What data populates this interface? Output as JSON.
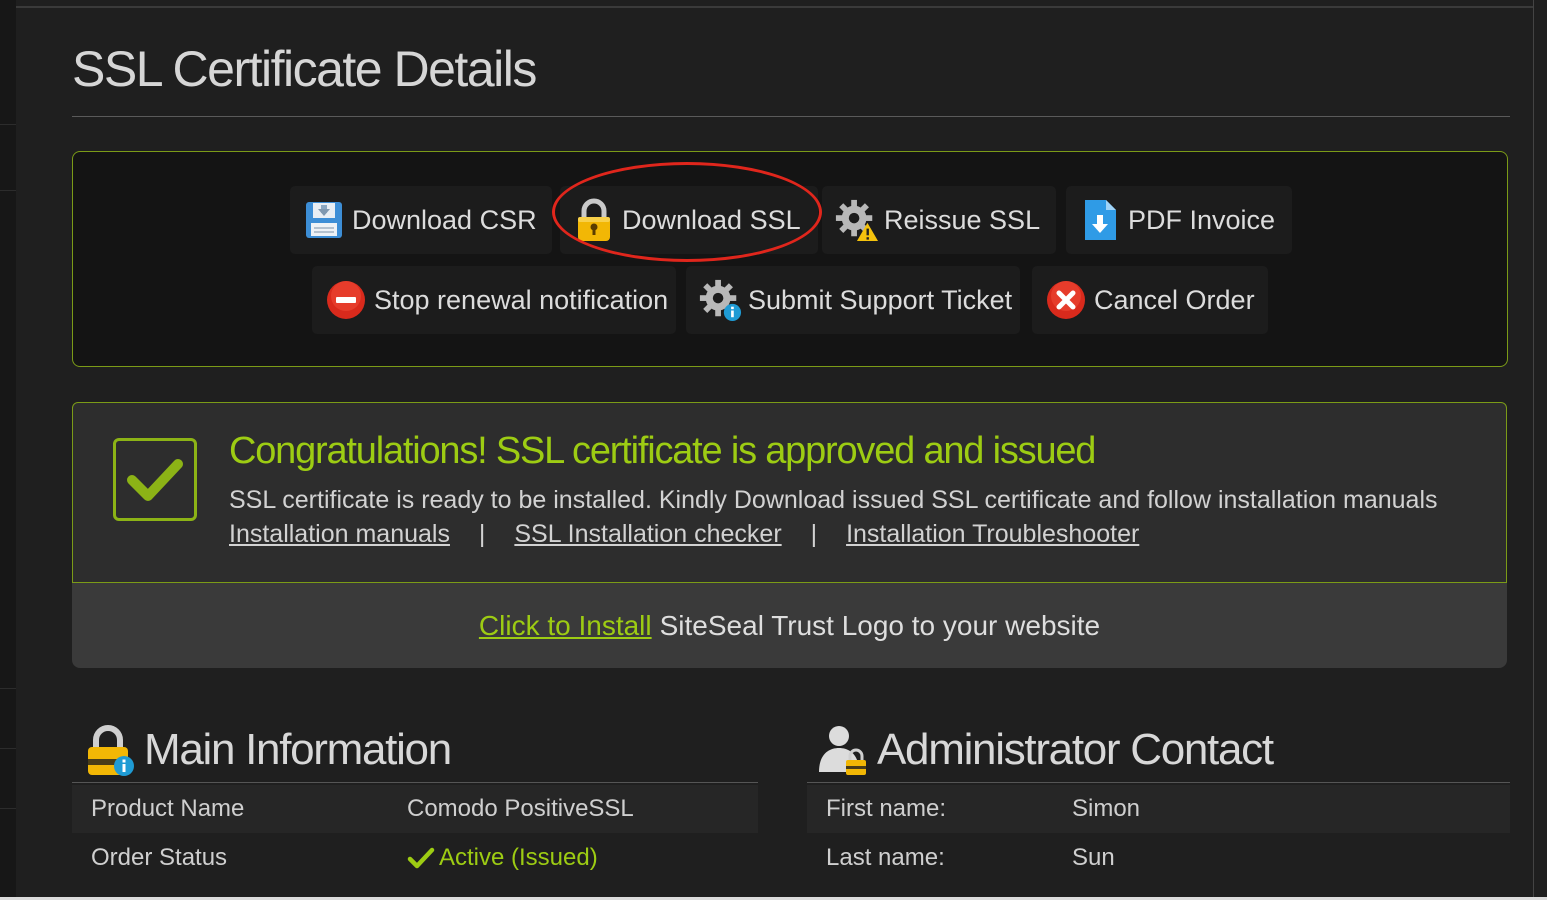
{
  "page": {
    "title": "SSL Certificate Details"
  },
  "actions": {
    "download_csr": "Download CSR",
    "download_ssl": "Download SSL",
    "reissue_ssl": "Reissue SSL",
    "pdf_invoice": "PDF Invoice",
    "stop_renewal": "Stop renewal notification",
    "submit_ticket": "Submit Support Ticket",
    "cancel_order": "Cancel Order"
  },
  "alert": {
    "title": "Congratulations! SSL certificate is approved and issued",
    "text": "SSL certificate is ready to be installed. Kindly Download issued SSL certificate and follow installation manuals",
    "links": [
      "Installation manuals",
      "SSL Installation checker",
      "Installation Troubleshooter"
    ],
    "separator": "|"
  },
  "siteseal": {
    "link": "Click to Install",
    "text": "SiteSeal Trust Logo to your website"
  },
  "main_info": {
    "title": "Main Information",
    "rows": [
      {
        "label": "Product Name",
        "value": "Comodo PositiveSSL"
      },
      {
        "label": "Order Status",
        "value": "Active (Issued)"
      }
    ]
  },
  "admin_contact": {
    "title": "Administrator Contact",
    "rows": [
      {
        "label": "First name:",
        "value": "Simon"
      },
      {
        "label": "Last name:",
        "value": "Sun"
      }
    ]
  },
  "colors": {
    "accent_green": "#9dcc13",
    "highlight_red": "#e0261c",
    "border_green": "#7b9b17"
  },
  "icons": [
    "floppy-disk-icon",
    "padlock-icon",
    "gear-warning-icon",
    "pdf-document-icon",
    "minus-circle-icon",
    "gear-info-icon",
    "x-circle-icon",
    "checkmark-icon",
    "lock-info-icon",
    "user-lock-icon"
  ]
}
